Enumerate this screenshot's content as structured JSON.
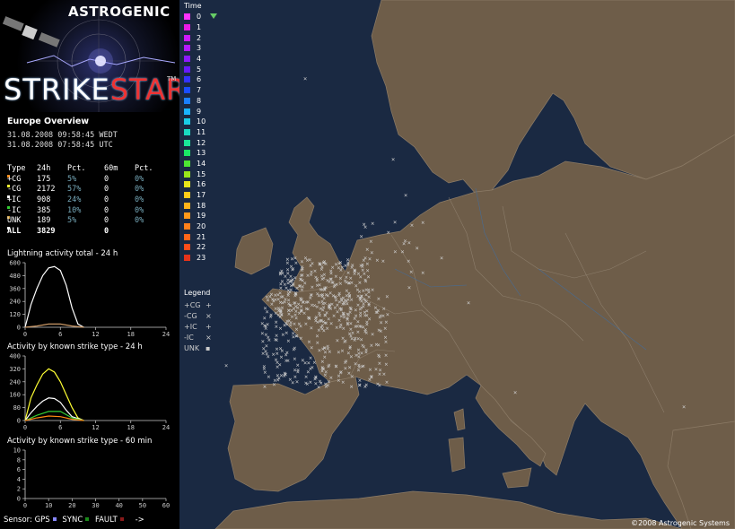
{
  "header": {
    "brand": "ASTROGENIC",
    "logo_main": "STRIKE",
    "logo_accent": "STAR",
    "logo_tm": "TM"
  },
  "overview": {
    "title": "Europe Overview",
    "time_local": "31.08.2008 09:58:45 WEDT",
    "time_utc": "31.08.2008 07:58:45 UTC"
  },
  "stats": {
    "headers": [
      "Type",
      "24h",
      "Pct.",
      "60m",
      "Pct."
    ],
    "rows": [
      {
        "type": "+CG",
        "h24": "175",
        "pct24": "5%",
        "m60": "0",
        "pct60": "0%",
        "color": "#ff8c1a"
      },
      {
        "type": "-CG",
        "h24": "2172",
        "pct24": "57%",
        "m60": "0",
        "pct60": "0%",
        "color": "#ffff33"
      },
      {
        "type": "+IC",
        "h24": "908",
        "pct24": "24%",
        "m60": "0",
        "pct60": "0%",
        "color": "#ffffff"
      },
      {
        "type": "-IC",
        "h24": "385",
        "pct24": "10%",
        "m60": "0",
        "pct60": "0%",
        "color": "#33cc33"
      },
      {
        "type": "UNK",
        "h24": "189",
        "pct24": "5%",
        "m60": "0",
        "pct60": "0%",
        "color": "#cc9933"
      }
    ],
    "total": {
      "type": "ALL",
      "h24": "3829",
      "m60": "0",
      "color": "#ffffff"
    }
  },
  "charts": {
    "total_24h": {
      "title": "Lightning activity total - 24 h",
      "yticks": [
        "600",
        "480",
        "360",
        "240",
        "120",
        "0"
      ],
      "xticks": [
        "0",
        "6",
        "12",
        "18",
        "24"
      ]
    },
    "type_24h": {
      "title": "Activity by known strike type - 24 h",
      "yticks": [
        "400",
        "320",
        "240",
        "160",
        "80",
        "0"
      ],
      "xticks": [
        "0",
        "6",
        "12",
        "18",
        "24"
      ]
    },
    "type_60m": {
      "title": "Activity by known strike type - 60 min",
      "yticks": [
        "10",
        "8",
        "6",
        "4",
        "2",
        "0"
      ],
      "xticks": [
        "0",
        "10",
        "20",
        "30",
        "40",
        "50",
        "60"
      ]
    }
  },
  "sensor": {
    "label": "Sensor:",
    "gps": "GPS",
    "sync": "SYNC",
    "fault": "FAULT",
    "arrow": "->",
    "gps_color": "#8888ff",
    "sync_color": "#1a8a1a",
    "fault_color": "#8a1a1a"
  },
  "time_legend": {
    "title": "Time",
    "items": [
      {
        "label": "0",
        "color": "#ff33ff"
      },
      {
        "label": "1",
        "color": "#e61ae6"
      },
      {
        "label": "2",
        "color": "#cc1aff"
      },
      {
        "label": "3",
        "color": "#b31aff"
      },
      {
        "label": "4",
        "color": "#8c1aff"
      },
      {
        "label": "5",
        "color": "#661aff"
      },
      {
        "label": "6",
        "color": "#3333ff"
      },
      {
        "label": "7",
        "color": "#1a4dff"
      },
      {
        "label": "8",
        "color": "#1a80ff"
      },
      {
        "label": "9",
        "color": "#1ab3ff"
      },
      {
        "label": "10",
        "color": "#1acce6"
      },
      {
        "label": "11",
        "color": "#1ad9c0"
      },
      {
        "label": "12",
        "color": "#1ae699"
      },
      {
        "label": "13",
        "color": "#1ae666"
      },
      {
        "label": "14",
        "color": "#4de633"
      },
      {
        "label": "15",
        "color": "#99e61a"
      },
      {
        "label": "16",
        "color": "#e6e61a"
      },
      {
        "label": "17",
        "color": "#ffcc1a"
      },
      {
        "label": "18",
        "color": "#ffb31a"
      },
      {
        "label": "19",
        "color": "#ff991a"
      },
      {
        "label": "20",
        "color": "#ff801a"
      },
      {
        "label": "21",
        "color": "#ff661a"
      },
      {
        "label": "22",
        "color": "#ff4d1a"
      },
      {
        "label": "23",
        "color": "#e6331a"
      }
    ]
  },
  "type_legend": {
    "title": "Legend",
    "items": [
      {
        "label": "+CG",
        "symbol": "+"
      },
      {
        "label": "-CG",
        "symbol": "×"
      },
      {
        "label": "+IC",
        "symbol": "+"
      },
      {
        "label": "-IC",
        "symbol": "×"
      },
      {
        "label": "UNK",
        "symbol": "▪"
      }
    ]
  },
  "footer": {
    "copyright": "©2008 Astrogenic Systems"
  },
  "colors": {
    "sea": "#1a2942",
    "land": "#6e5d49",
    "border": "#9a8c7a",
    "river": "#3d6fa8"
  }
}
